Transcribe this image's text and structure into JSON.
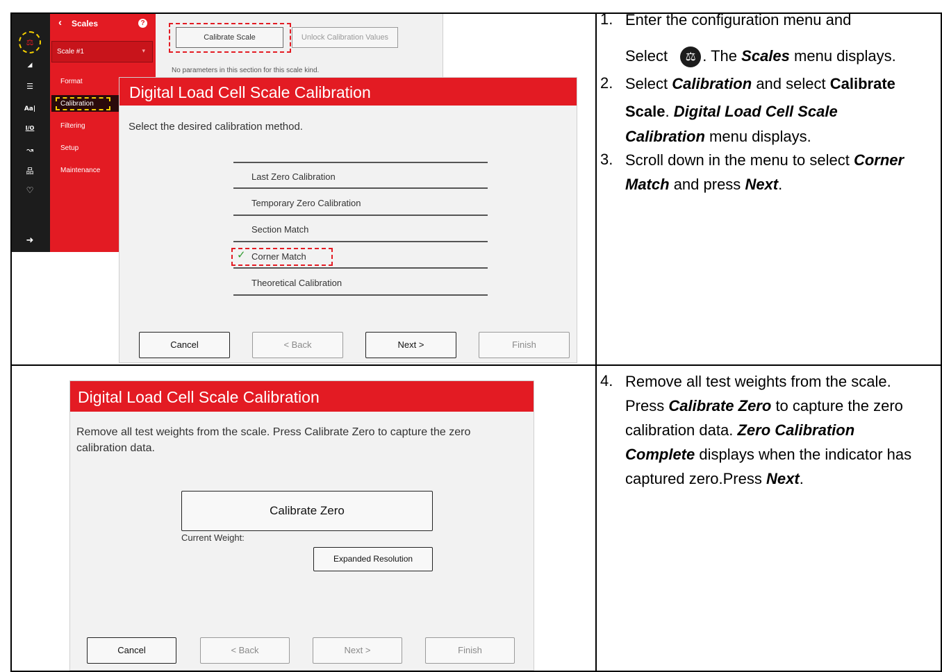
{
  "top_screenshot": {
    "sidebar": {
      "header_title": "Scales",
      "back_glyph": "‹",
      "help_glyph": "?",
      "scale_select": "Scale #1",
      "items": [
        "Format",
        "Calibration",
        "Filtering",
        "Setup",
        "Maintenance"
      ],
      "active_item": "Calibration",
      "icons": [
        "scales-icon",
        "wifi-icon",
        "list-icon",
        "font-icon",
        "io-icon",
        "route-icon",
        "network-icon",
        "health-icon",
        "exit-icon"
      ],
      "icon_glyphs": {
        "scales": "⚖",
        "wifi": "◢",
        "list": "☰",
        "font": "Aa|",
        "io": "I/O",
        "route": "↝",
        "network": "品",
        "health": "♡",
        "exit": "➜"
      }
    },
    "config_panel": {
      "calibrate_scale_button": "Calibrate Scale",
      "unlock_button": "Unlock Calibration Values",
      "no_params_text": "No parameters in this section for this scale kind."
    },
    "dialog": {
      "title": "Digital Load Cell Scale Calibration",
      "prompt": "Select the desired calibration method.",
      "options": [
        "Last Zero Calibration",
        "Temporary Zero Calibration",
        "Section Match",
        "Corner Match",
        "Theoretical Calibration"
      ],
      "selected_option": "Corner Match",
      "check_glyph": "✓",
      "buttons": {
        "cancel": "Cancel",
        "back": "< Back",
        "next": "Next >",
        "finish": "Finish"
      }
    }
  },
  "bottom_screenshot": {
    "title": "Digital Load Cell Scale Calibration",
    "instruction_line1": "Remove all test weights from the scale. Press Calibrate Zero to capture the zero",
    "instruction_line2": "calibration data.",
    "calibrate_zero_button": "Calibrate Zero",
    "current_weight_label": "Current Weight:",
    "expanded_resolution_button": "Expanded Resolution",
    "buttons": {
      "cancel": "Cancel",
      "back": "< Back",
      "next": "Next >",
      "finish": "Finish"
    }
  },
  "instructions": {
    "step1": {
      "number": "1.",
      "line1": "Enter the configuration menu and",
      "line2_pre": "Select",
      "line2_post": ". The",
      "scales_word": "Scales",
      "line2_end": "menu displays."
    },
    "step2": {
      "number": "2.",
      "select": "Select",
      "calibration_word": "Calibration",
      "and_select": "and select",
      "calibrate_word": "Calibrate",
      "scale_word": "Scale",
      "period": ".",
      "dlc_line1": "Digital Load Cell Scale",
      "dlc_line2": "Calibration",
      "menu_displays": "menu displays."
    },
    "step3": {
      "number": "3.",
      "line1_pre": "Scroll down in the menu to select",
      "corner_word": "Corner",
      "match_word": "Match",
      "and_press": "and press",
      "next_word": "Next",
      "period": "."
    },
    "step4": {
      "number": "4.",
      "line1": "Remove all test weights from the scale.",
      "press": "Press",
      "calibrate_zero": "Calibrate Zero",
      "to_capture": "to capture the zero",
      "line3_pre": "calibration data.",
      "zero_calibration": "Zero Calibration",
      "complete": "Complete",
      "displays_when": "displays when the indicator has",
      "captured": "captured zero.Press",
      "next_word": "Next",
      "period": "."
    }
  },
  "colors": {
    "brand_red": "#e31b23",
    "sidebar_dark": "#1c1c1c",
    "highlight_yellow": "#f5d000",
    "check_green": "#2e9b2e"
  }
}
